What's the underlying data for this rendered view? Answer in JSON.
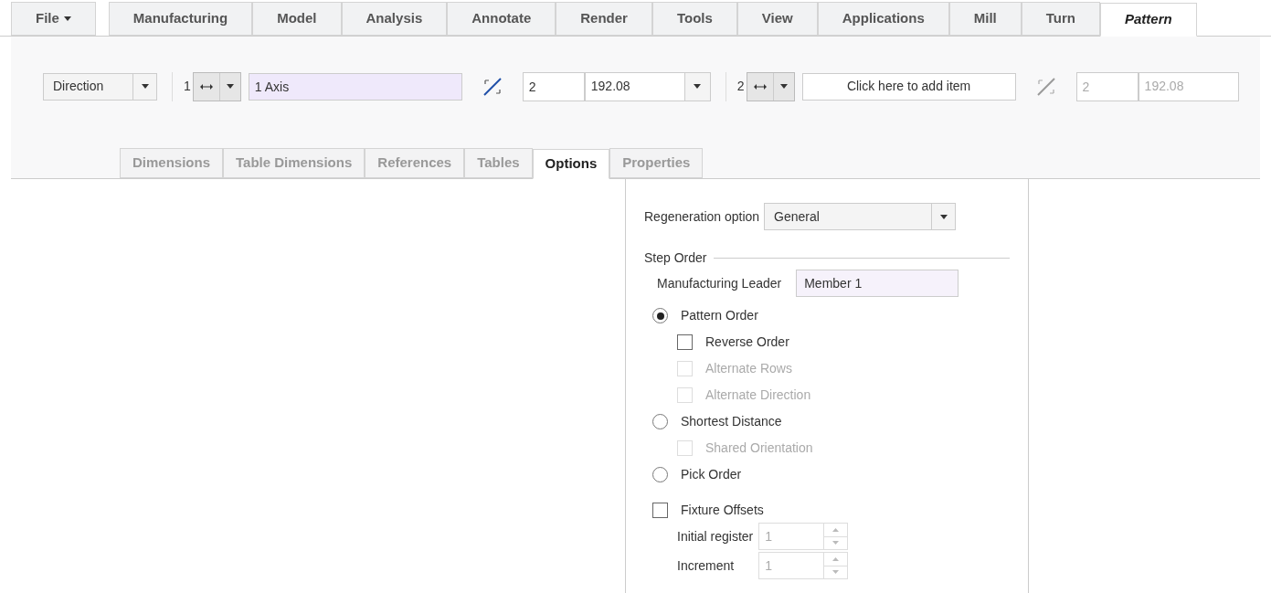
{
  "menu_tabs": [
    {
      "label": "File",
      "kind": "menu",
      "selected": false
    },
    {
      "label": "Manufacturing",
      "kind": "tab",
      "selected": false
    },
    {
      "label": "Model",
      "kind": "tab",
      "selected": false
    },
    {
      "label": "Analysis",
      "kind": "tab",
      "selected": false
    },
    {
      "label": "Annotate",
      "kind": "tab",
      "selected": false
    },
    {
      "label": "Render",
      "kind": "tab",
      "selected": false
    },
    {
      "label": "Tools",
      "kind": "tab",
      "selected": false
    },
    {
      "label": "View",
      "kind": "tab",
      "selected": false
    },
    {
      "label": "Applications",
      "kind": "tab",
      "selected": false
    },
    {
      "label": "Mill",
      "kind": "tab",
      "selected": false
    },
    {
      "label": "Turn",
      "kind": "tab",
      "selected": false
    },
    {
      "label": "Pattern",
      "kind": "tab",
      "selected": true
    }
  ],
  "ribbon": {
    "type_dropdown": {
      "value": "Direction"
    },
    "directions": [
      {
        "index": "1",
        "reference": "1 Axis",
        "kind": "value",
        "count": "2",
        "spacing": "192.08",
        "disabled": false
      },
      {
        "index": "2",
        "reference": "Click here to add item",
        "kind": "prompt",
        "count": "2",
        "spacing": "192.08",
        "disabled": true
      }
    ]
  },
  "sub_tabs": [
    {
      "label": "Dimensions",
      "selected": false
    },
    {
      "label": "Table Dimensions",
      "selected": false
    },
    {
      "label": "References",
      "selected": false
    },
    {
      "label": "Tables",
      "selected": false
    },
    {
      "label": "Options",
      "selected": true
    },
    {
      "label": "Properties",
      "selected": false
    }
  ],
  "options_panel": {
    "regeneration": {
      "label": "Regeneration option",
      "value": "General"
    },
    "step_order": {
      "title": "Step Order",
      "leader_label": "Manufacturing Leader",
      "leader_value": "Member 1"
    },
    "order_choices": [
      {
        "kind": "radio",
        "label": "Pattern Order",
        "selected": true,
        "disabled": false,
        "children": [
          {
            "kind": "checkbox",
            "label": "Reverse Order",
            "checked": false,
            "disabled": false
          },
          {
            "kind": "checkbox",
            "label": "Alternate Rows",
            "checked": false,
            "disabled": true
          },
          {
            "kind": "checkbox",
            "label": "Alternate Direction",
            "checked": false,
            "disabled": true
          }
        ]
      },
      {
        "kind": "radio",
        "label": "Shortest Distance",
        "selected": false,
        "disabled": false,
        "children": [
          {
            "kind": "checkbox",
            "label": "Shared Orientation",
            "checked": false,
            "disabled": true
          }
        ]
      },
      {
        "kind": "radio",
        "label": "Pick Order",
        "selected": false,
        "disabled": false
      }
    ],
    "fixture": {
      "label": "Fixture Offsets",
      "checked": false,
      "fields": [
        {
          "label": "Initial register",
          "value": "1",
          "disabled": true
        },
        {
          "label": "Increment",
          "value": "1",
          "disabled": true
        }
      ]
    }
  }
}
